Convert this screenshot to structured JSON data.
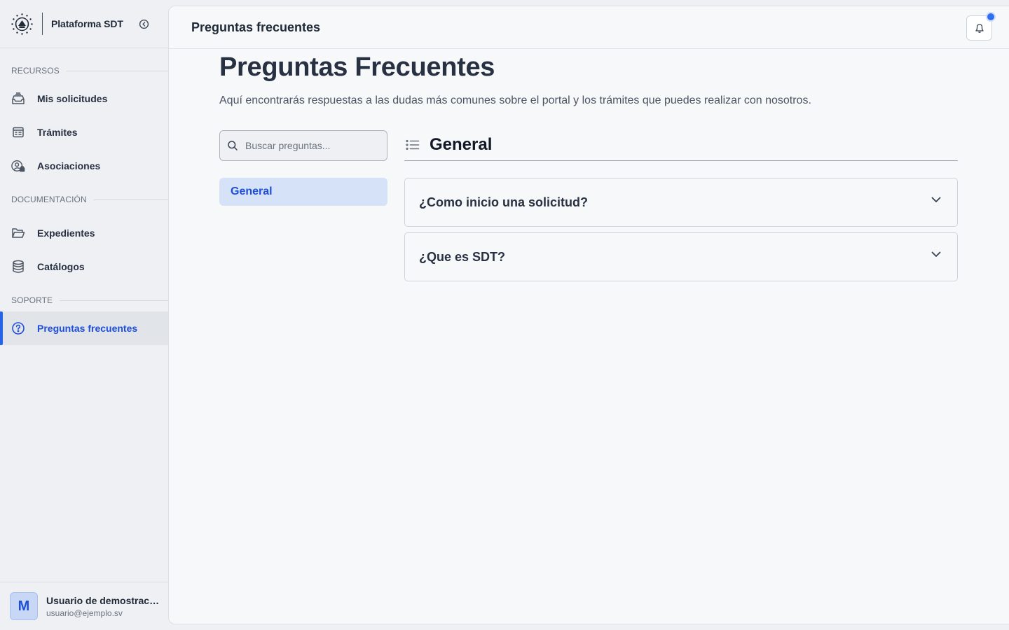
{
  "brand": {
    "name": "Plataforma SDT"
  },
  "sidebar": {
    "sections": [
      {
        "label": "RECURSOS"
      },
      {
        "label": "DOCUMENTACIÓN"
      },
      {
        "label": "SOPORTE"
      }
    ],
    "items": [
      {
        "label": "Mis solicitudes",
        "icon": "inbox-stack-icon"
      },
      {
        "label": "Trámites",
        "icon": "form-calendar-icon"
      },
      {
        "label": "Asociaciones",
        "icon": "user-group-lock-icon"
      },
      {
        "label": "Expedientes",
        "icon": "folder-open-icon"
      },
      {
        "label": "Catálogos",
        "icon": "database-icon"
      },
      {
        "label": "Preguntas frecuentes",
        "icon": "question-circle-icon",
        "active": true
      }
    ]
  },
  "user": {
    "initial": "M",
    "name": "Usuario de demostración",
    "email": "usuario@ejemplo.sv"
  },
  "header": {
    "title": "Preguntas frecuentes"
  },
  "main": {
    "title": "Preguntas Frecuentes",
    "description": "Aquí encontrarás respuestas a las dudas más comunes sobre el portal y los trámites que puedes realizar con nosotros.",
    "search": {
      "placeholder": "Buscar preguntas...",
      "value": ""
    },
    "categories": [
      {
        "label": "General",
        "selected": true
      }
    ],
    "section_title": "General",
    "faqs": [
      {
        "question": "¿Como inicio una solicitud?",
        "expanded": false
      },
      {
        "question": "¿Que es SDT?",
        "expanded": false
      }
    ]
  },
  "colors": {
    "accent": "#2563eb",
    "active_text": "#1d4ed8",
    "category_bg": "#d6e2f7",
    "notification_dot": "#2f6ff0"
  }
}
